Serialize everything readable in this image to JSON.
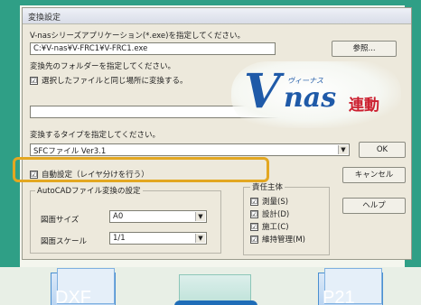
{
  "dialog": {
    "title": "変換設定",
    "sdf_prompt": "V-nasシリーズアプリケーション(*.exe)を指定してください。",
    "sdf_path": "C:¥V-nas¥V-FRC1¥V-FRC1.exe",
    "browse_label": "参照...",
    "folder_prompt": "変換先のフォルダーを指定してください。",
    "same_folder_label": "選択したファイルと同じ場所に変換する。",
    "same_folder_checked": "☑",
    "folder_path": "",
    "type_prompt": "変換するタイプを指定してください。",
    "type_value": "SFCファイル Ver3.1",
    "ok_label": "OK",
    "cancel_label": "キャンセル",
    "help_label": "ヘルプ",
    "auto_setting_label": "自動設定（レイヤ分けを行う）",
    "auto_setting_checked": "☑",
    "autocad_group_label": "AutoCADファイル変換の設定",
    "paper_size_label": "図面サイズ",
    "paper_size_value": "A0",
    "scale_label": "図面スケール",
    "scale_value": "1/1",
    "target_group_label": "責任主体",
    "targets": [
      {
        "label": "測量(S)",
        "checked": "☑"
      },
      {
        "label": "設計(D)",
        "checked": "☑"
      },
      {
        "label": "施工(C)",
        "checked": "☑"
      },
      {
        "label": "維持管理(M)",
        "checked": "☑"
      }
    ],
    "dropdown_glyph": "▼"
  },
  "logo": {
    "v": "V",
    "nas": "nas",
    "kana": "ヴィーナス",
    "renkei": "連動"
  },
  "file_icons": [
    {
      "ext": "DXF"
    },
    {
      "ext": ""
    },
    {
      "ext": "P21"
    }
  ],
  "colors": {
    "frame_green": "#2f9f86",
    "highlight": "#e3a721",
    "logo_blue": "#1f5aa8",
    "logo_red": "#cc1f2f"
  }
}
